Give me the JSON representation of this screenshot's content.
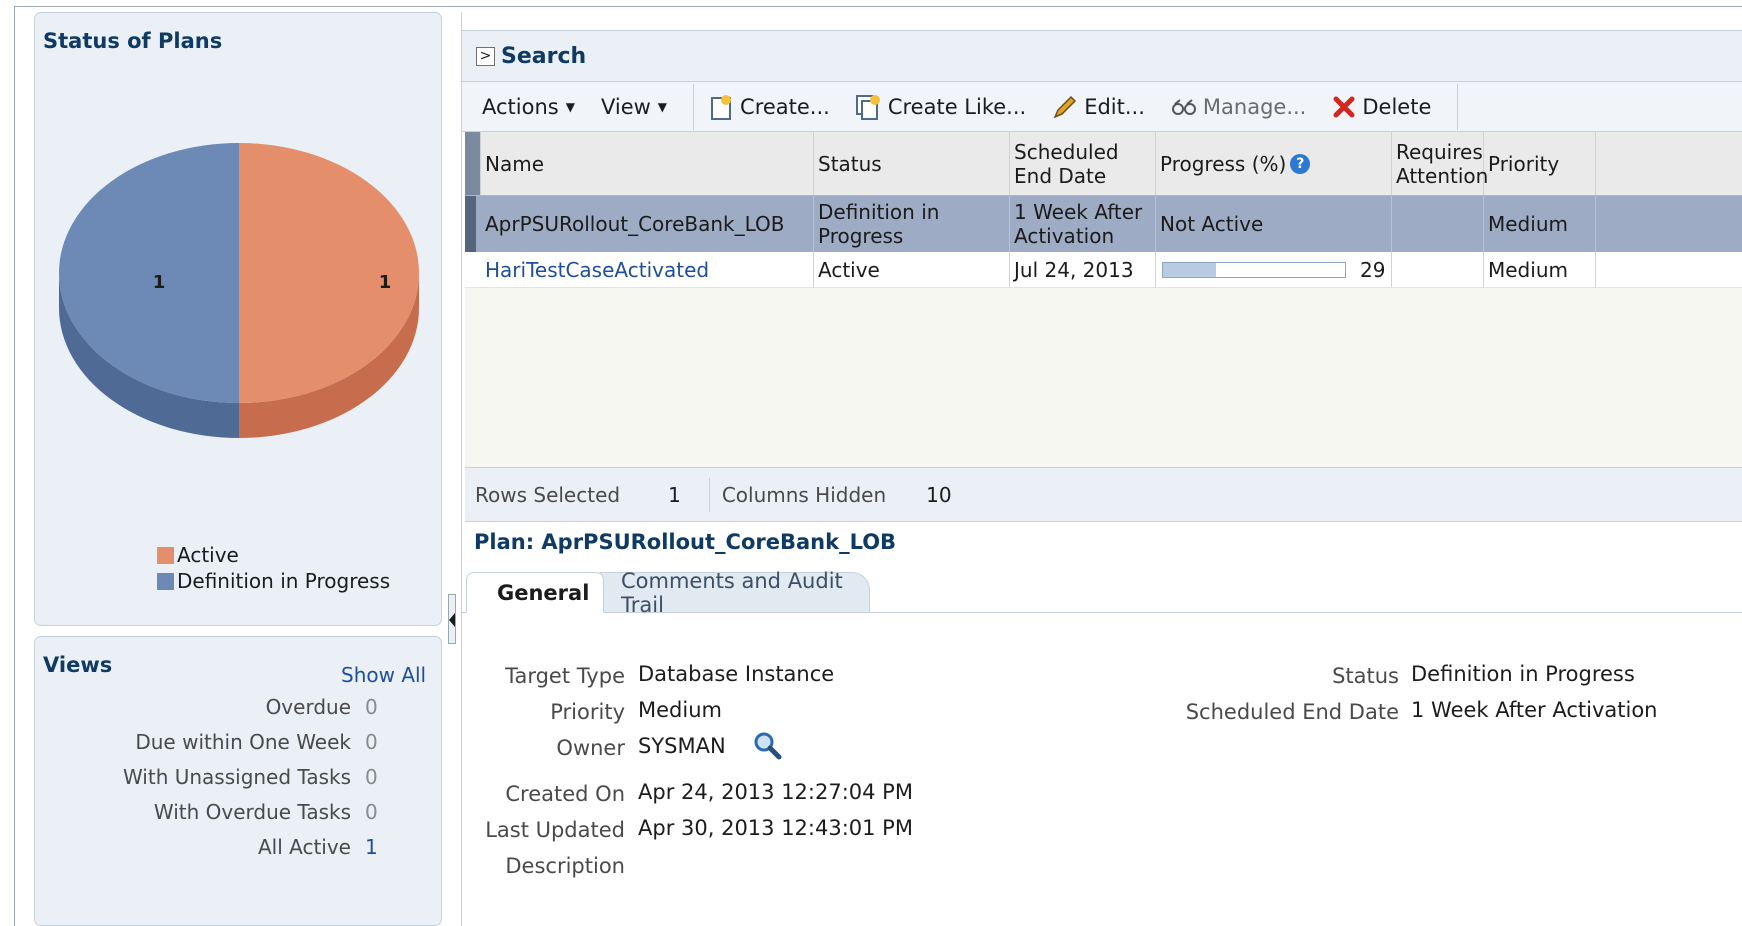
{
  "status_panel": {
    "title": "Status of Plans",
    "chart_data": {
      "type": "pie",
      "categories": [
        "Active",
        "Definition in Progress"
      ],
      "values": [
        1,
        1
      ],
      "colors": [
        "#e58e6c",
        "#6c8ab5"
      ],
      "legend_position": "bottom"
    },
    "legend": [
      {
        "label": "Active",
        "color": "#e58e6c"
      },
      {
        "label": "Definition in Progress",
        "color": "#6c8ab5"
      }
    ]
  },
  "views_panel": {
    "title": "Views",
    "show_all": "Show All",
    "items": [
      {
        "label": "Overdue",
        "count": "0"
      },
      {
        "label": "Due within One Week",
        "count": "0"
      },
      {
        "label": "With Unassigned Tasks",
        "count": "0"
      },
      {
        "label": "With Overdue Tasks",
        "count": "0"
      },
      {
        "label": "All Active",
        "count": "1"
      }
    ]
  },
  "search": {
    "title": "Search"
  },
  "toolbar": {
    "actions": "Actions",
    "view": "View",
    "create": "Create...",
    "create_like": "Create Like...",
    "edit": "Edit...",
    "manage": "Manage...",
    "delete": "Delete"
  },
  "table": {
    "columns": [
      "Name",
      "Status",
      "Scheduled End Date",
      "Progress (%)",
      "Requires Attention",
      "Priority"
    ],
    "rows": [
      {
        "name": "AprPSURollout_CoreBank_LOB",
        "status": "Definition in Progress",
        "end_date": "1 Week After Activation",
        "progress_text": "Not Active",
        "requires_attention": "",
        "priority": "Medium"
      },
      {
        "name": "HariTestCaseActivated",
        "status": "Active",
        "end_date": "Jul 24, 2013",
        "progress_value": "29",
        "progress_fraction": 0.29,
        "requires_attention": "",
        "priority": "Medium"
      }
    ],
    "footer": {
      "rows_selected_label": "Rows Selected",
      "rows_selected": "1",
      "columns_hidden_label": "Columns Hidden",
      "columns_hidden": "10"
    }
  },
  "detail": {
    "title": "Plan: AprPSURollout_CoreBank_LOB",
    "tabs": [
      "General",
      "Comments and Audit Trail"
    ],
    "fields": {
      "target_type_label": "Target Type",
      "target_type": "Database Instance",
      "priority_label": "Priority",
      "priority": "Medium",
      "owner_label": "Owner",
      "owner": "SYSMAN",
      "created_on_label": "Created On",
      "created_on": "Apr 24, 2013 12:27:04 PM",
      "last_updated_label": "Last Updated",
      "last_updated": "Apr 30, 2013 12:43:01 PM",
      "description_label": "Description",
      "status_label": "Status",
      "status": "Definition in Progress",
      "end_date_label": "Scheduled End Date",
      "end_date": "1 Week After Activation"
    }
  }
}
